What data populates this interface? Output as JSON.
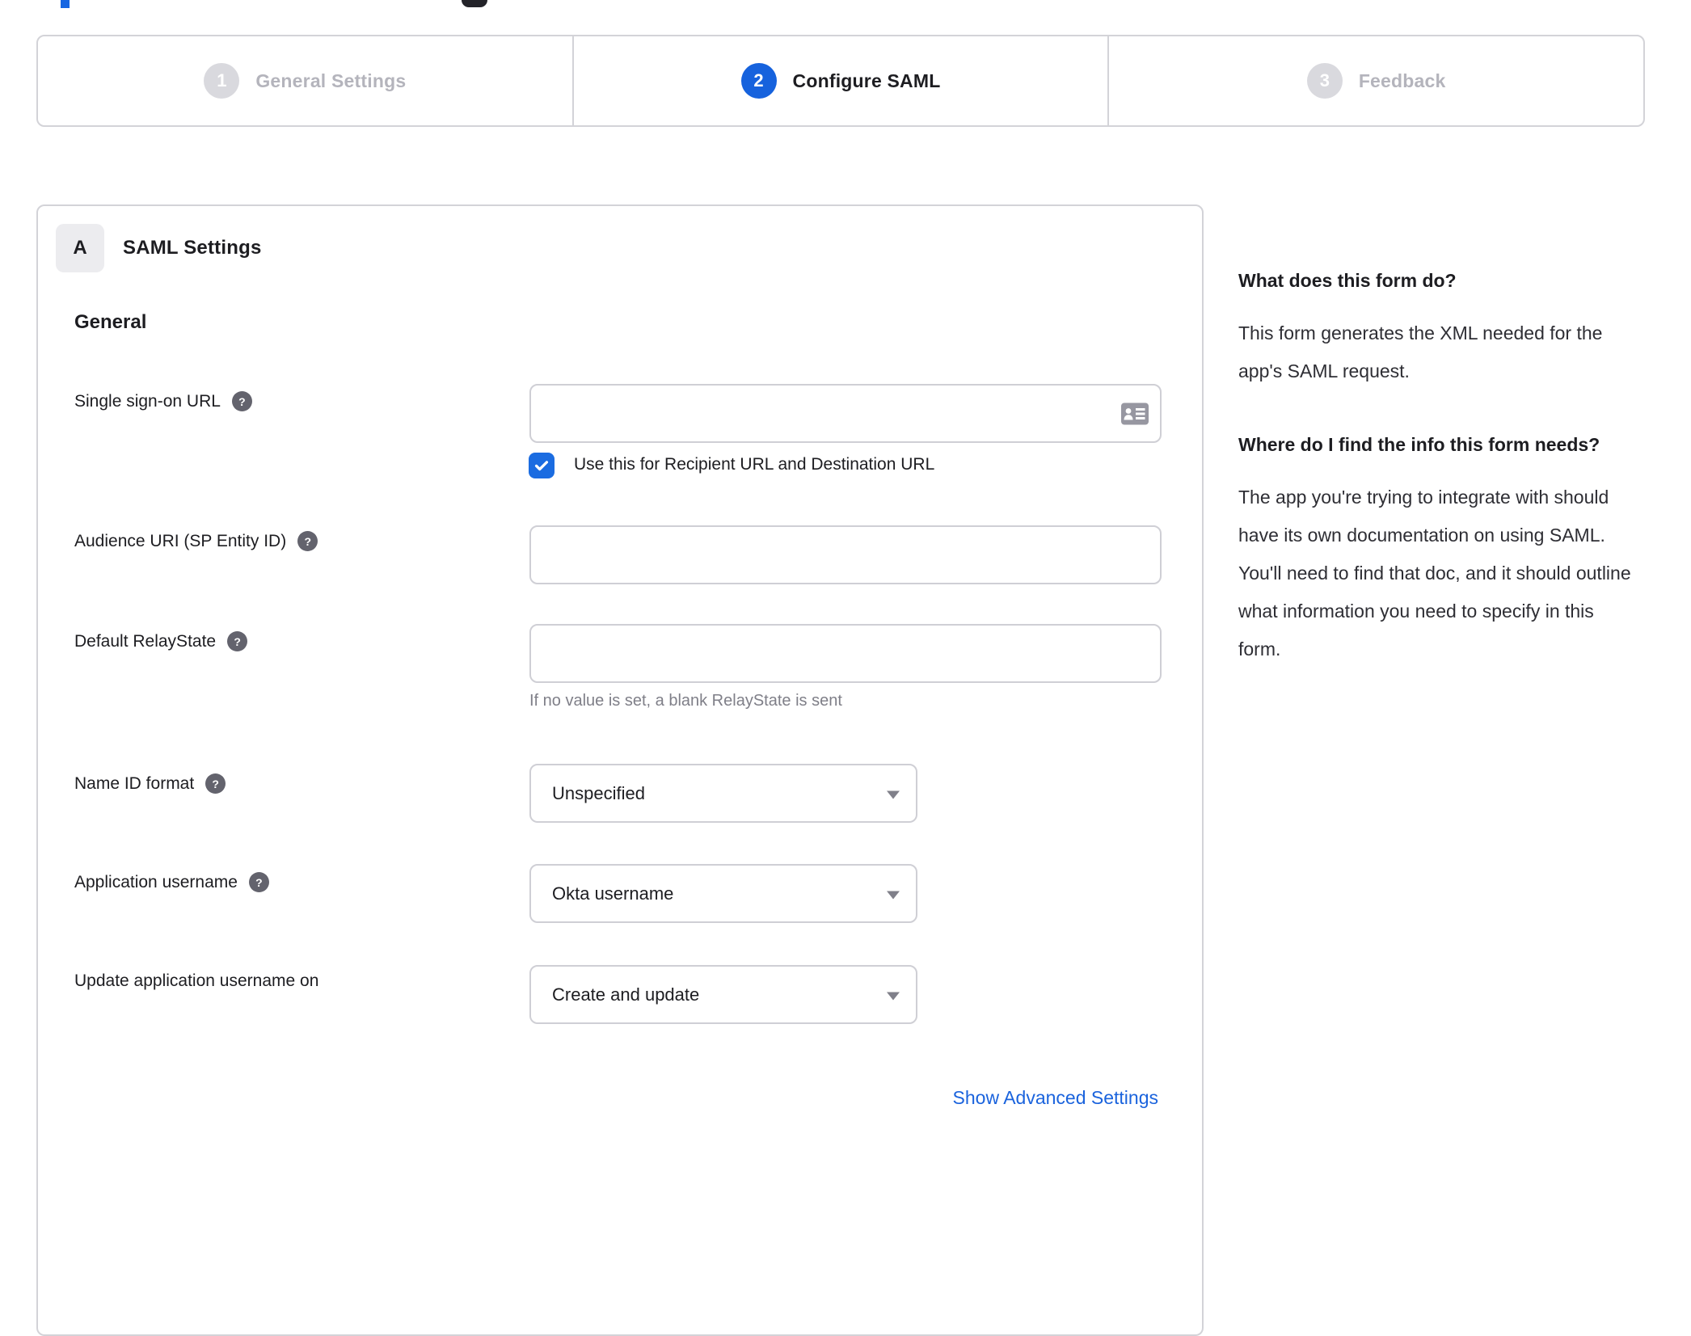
{
  "stepper": {
    "steps": [
      {
        "number": "1",
        "label": "General Settings",
        "state": "inactive"
      },
      {
        "number": "2",
        "label": "Configure SAML",
        "state": "active"
      },
      {
        "number": "3",
        "label": "Feedback",
        "state": "inactive"
      }
    ]
  },
  "panel": {
    "badge_label": "A",
    "title": "SAML Settings",
    "section_heading": "General",
    "fields": {
      "sso": {
        "label": "Single sign-on URL",
        "value": "",
        "checkbox_label": "Use this for Recipient URL and Destination URL",
        "checked": true
      },
      "audience": {
        "label": "Audience URI (SP Entity ID)",
        "value": ""
      },
      "relay": {
        "label": "Default RelayState",
        "value": "",
        "hint": "If no value is set, a blank RelayState is sent"
      },
      "name_id": {
        "label": "Name ID format",
        "value": "Unspecified"
      },
      "app_username": {
        "label": "Application username",
        "value": "Okta username"
      },
      "update_username": {
        "label": "Update application username on",
        "value": "Create and update"
      }
    },
    "advanced_link_label": "Show Advanced Settings"
  },
  "sidebar": {
    "blocks": [
      {
        "heading": "What does this form do?",
        "body": "This form generates the XML needed for the app's SAML request."
      },
      {
        "heading": "Where do I find the info this form needs?",
        "body": "The app you're trying to integrate with should have its own documentation on using SAML. You'll need to find that doc, and it should outline what information you need to specify in this form."
      }
    ]
  },
  "icons": {
    "help": "question-mark-circle",
    "sso_input": "contact-card",
    "select_caret": "caret-down",
    "checkbox": "checkmark"
  },
  "colors": {
    "accent": "#1662dd",
    "checkbox": "#1b6ce1",
    "link": "#1a63dd",
    "inactive_step_circle": "#d9d9de",
    "inactive_step_label": "#b4b4bc",
    "border": "#d3d3d8",
    "text": "#1d1d21",
    "muted_hint": "#7f7f88",
    "help_icon": "#63636d"
  }
}
